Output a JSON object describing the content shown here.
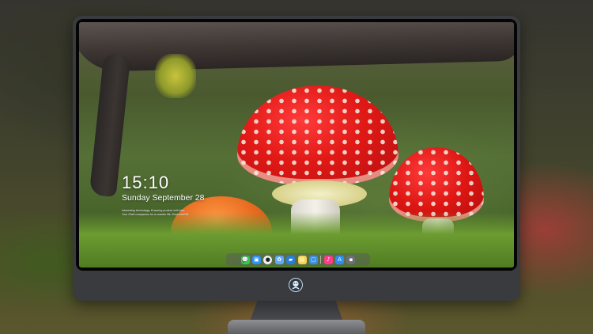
{
  "lockscreen": {
    "time": "15:10",
    "date": "Sunday September 28",
    "notice_line_1": "Interesting technology: Ensuring product with Mac",
    "notice_line_2": "Your Shell companion for a smarter life: EssentialStik"
  },
  "dock": {
    "items": [
      {
        "name": "messages",
        "glyph": "💬",
        "color": "#34c759"
      },
      {
        "name": "finder",
        "glyph": "▣",
        "color": "#2f8ff5"
      },
      {
        "name": "clock",
        "glyph": "●",
        "color": "#f0f0f0"
      },
      {
        "name": "photos",
        "glyph": "✿",
        "color": "#5fa8ff"
      },
      {
        "name": "clapper",
        "glyph": "▰",
        "color": "#2a7dd6"
      },
      {
        "name": "notes",
        "glyph": "▤",
        "color": "#f5d454"
      },
      {
        "name": "preview",
        "glyph": "▢",
        "color": "#3e8de0"
      },
      {
        "name": "music",
        "glyph": "♪",
        "color": "#ff3b8b"
      },
      {
        "name": "app-store",
        "glyph": "A",
        "color": "#2f8df5"
      },
      {
        "name": "system",
        "glyph": "▪",
        "color": "#6b6f76"
      }
    ]
  },
  "colors": {
    "monitor": "#3a3b3f",
    "accent_red": "#e11916"
  }
}
